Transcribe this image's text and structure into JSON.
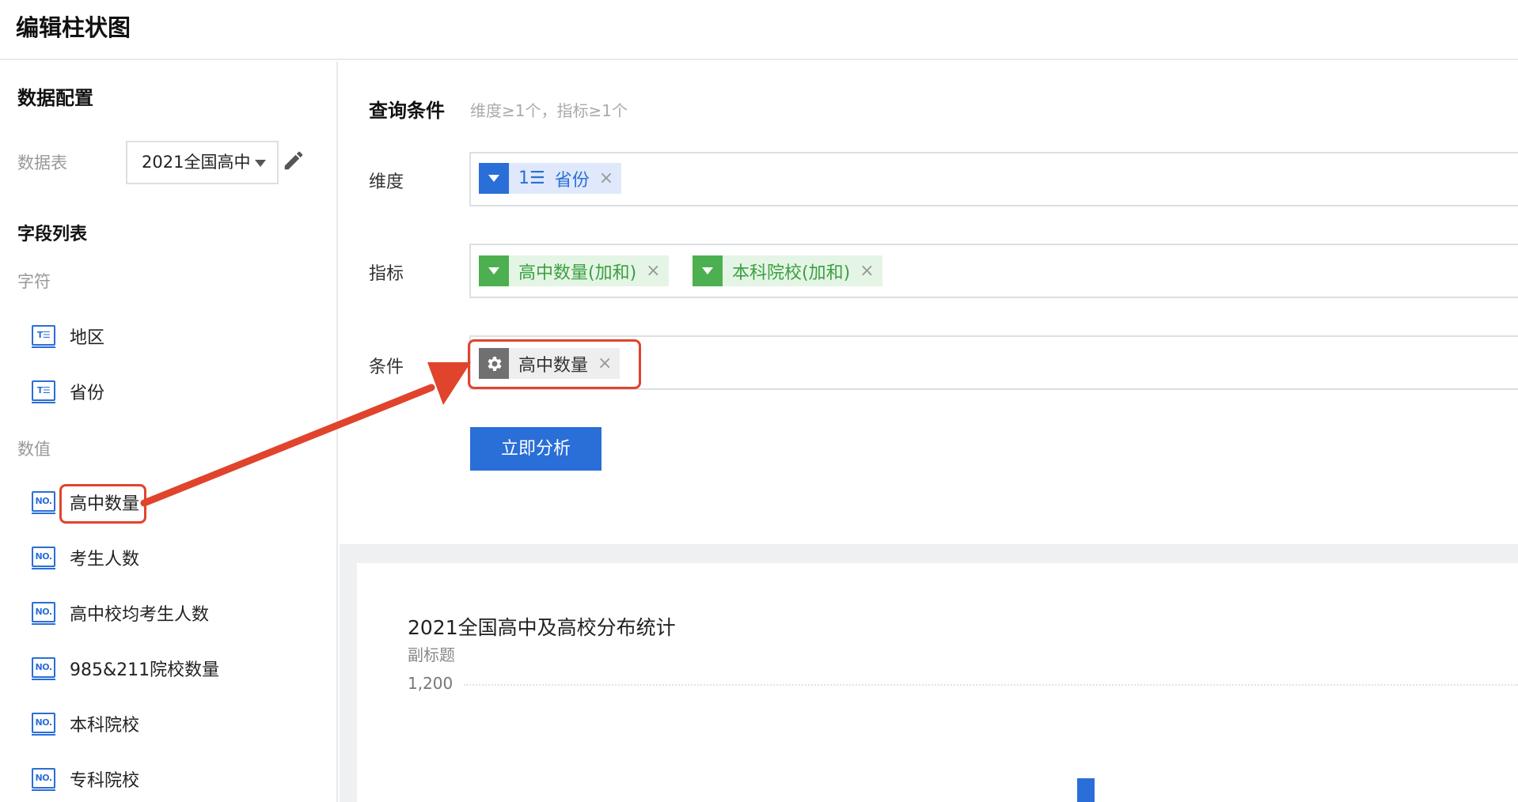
{
  "header": {
    "title": "编辑柱状图"
  },
  "sidebar": {
    "data_config_title": "数据配置",
    "table_label": "数据表",
    "table_value": "2021全国高中",
    "field_list_title": "字段列表",
    "char_group_label": "字符",
    "num_group_label": "数值",
    "char_fields": [
      {
        "label": "地区",
        "icon": "text-field-icon"
      },
      {
        "label": "省份",
        "icon": "text-field-icon"
      }
    ],
    "num_fields": [
      {
        "label": "高中数量",
        "icon": "number-field-icon"
      },
      {
        "label": "考生人数",
        "icon": "number-field-icon"
      },
      {
        "label": "高中校均考生人数",
        "icon": "number-field-icon"
      },
      {
        "label": "985&211院校数量",
        "icon": "number-field-icon"
      },
      {
        "label": "本科院校",
        "icon": "number-field-icon"
      },
      {
        "label": "专科院校",
        "icon": "number-field-icon"
      }
    ],
    "icon_text": {
      "text": "T☰",
      "number": "NO."
    }
  },
  "query": {
    "title": "查询条件",
    "hint": "维度≥1个，指标≥1个",
    "dimension_label": "维度",
    "dimension_tags": [
      {
        "label": "省份",
        "prefix": "1☰"
      }
    ],
    "measure_label": "指标",
    "measure_tags": [
      {
        "label": "高中数量(加和)"
      },
      {
        "label": "本科院校(加和)"
      }
    ],
    "condition_label": "条件",
    "condition_tags": [
      {
        "label": "高中数量"
      }
    ],
    "close_glyph": "×",
    "analyze_button": "立即分析"
  },
  "chart": {
    "title": "2021全国高中及高校分布统计",
    "subtitle": "副标题"
  },
  "chart_data": {
    "type": "bar",
    "title": "2021全国高中及高校分布统计",
    "subtitle": "副标题",
    "yticks": [
      "1,200"
    ],
    "grid": true
  },
  "colors": {
    "accent": "#2a6ed8",
    "measure": "#4caf50",
    "highlight": "#e0442c"
  }
}
